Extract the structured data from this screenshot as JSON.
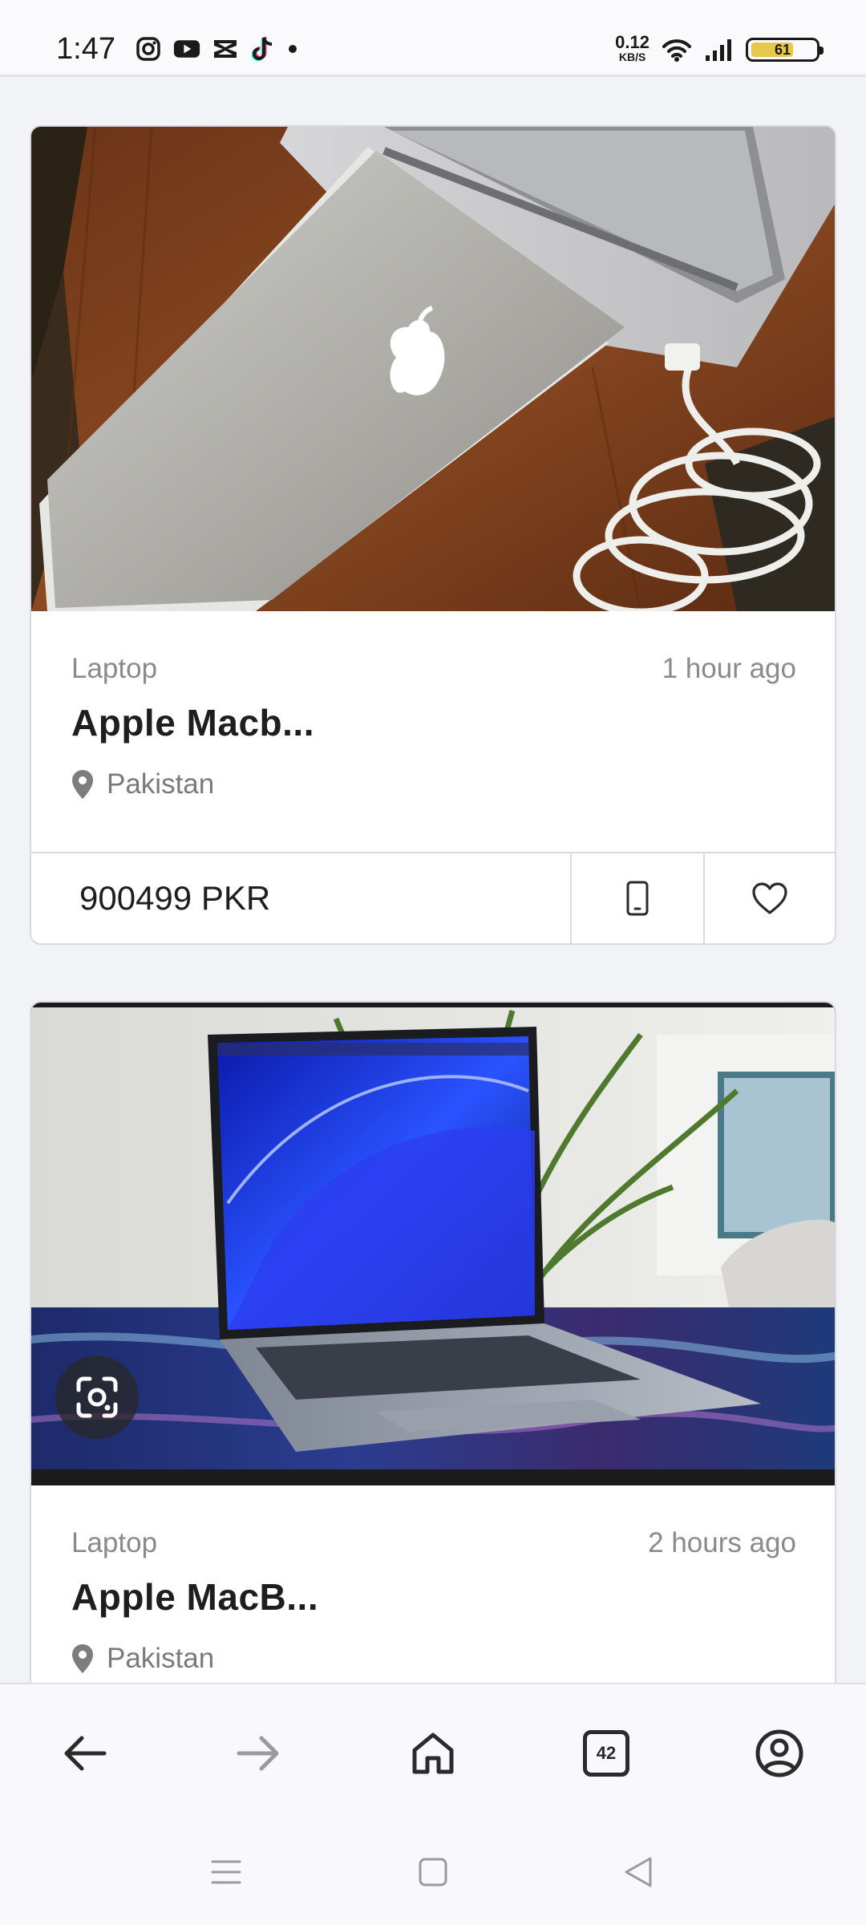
{
  "status_bar": {
    "time": "1:47",
    "net_speed_value": "0.12",
    "net_speed_unit": "KB/S",
    "battery": "61",
    "app_icons": [
      "instagram-icon",
      "youtube-icon",
      "capcut-icon",
      "tiktok-icon"
    ]
  },
  "listings": [
    {
      "category": "Laptop",
      "posted": "1 hour ago",
      "title": "Apple Macb...",
      "location": "Pakistan",
      "price": "900499 PKR",
      "image": "silver-macbook-on-wooden-table-photo"
    },
    {
      "category": "Laptop",
      "posted": "2 hours ago",
      "title": "Apple MacB...",
      "location": "Pakistan",
      "image": "macbook-air-blue-wallpaper-photo"
    }
  ],
  "browser_bar": {
    "tab_count": "42",
    "icons": [
      "back-arrow-icon",
      "forward-arrow-icon",
      "home-icon",
      "tabs-icon",
      "account-icon"
    ]
  },
  "system_nav": {
    "icons": [
      "menu-icon",
      "home-square-icon",
      "back-triangle-icon"
    ]
  },
  "colors": {
    "page_background": "#f2f3f6",
    "card_background": "#ffffff",
    "muted_text": "#8a8a8a",
    "title_text": "#1e1e1e"
  }
}
